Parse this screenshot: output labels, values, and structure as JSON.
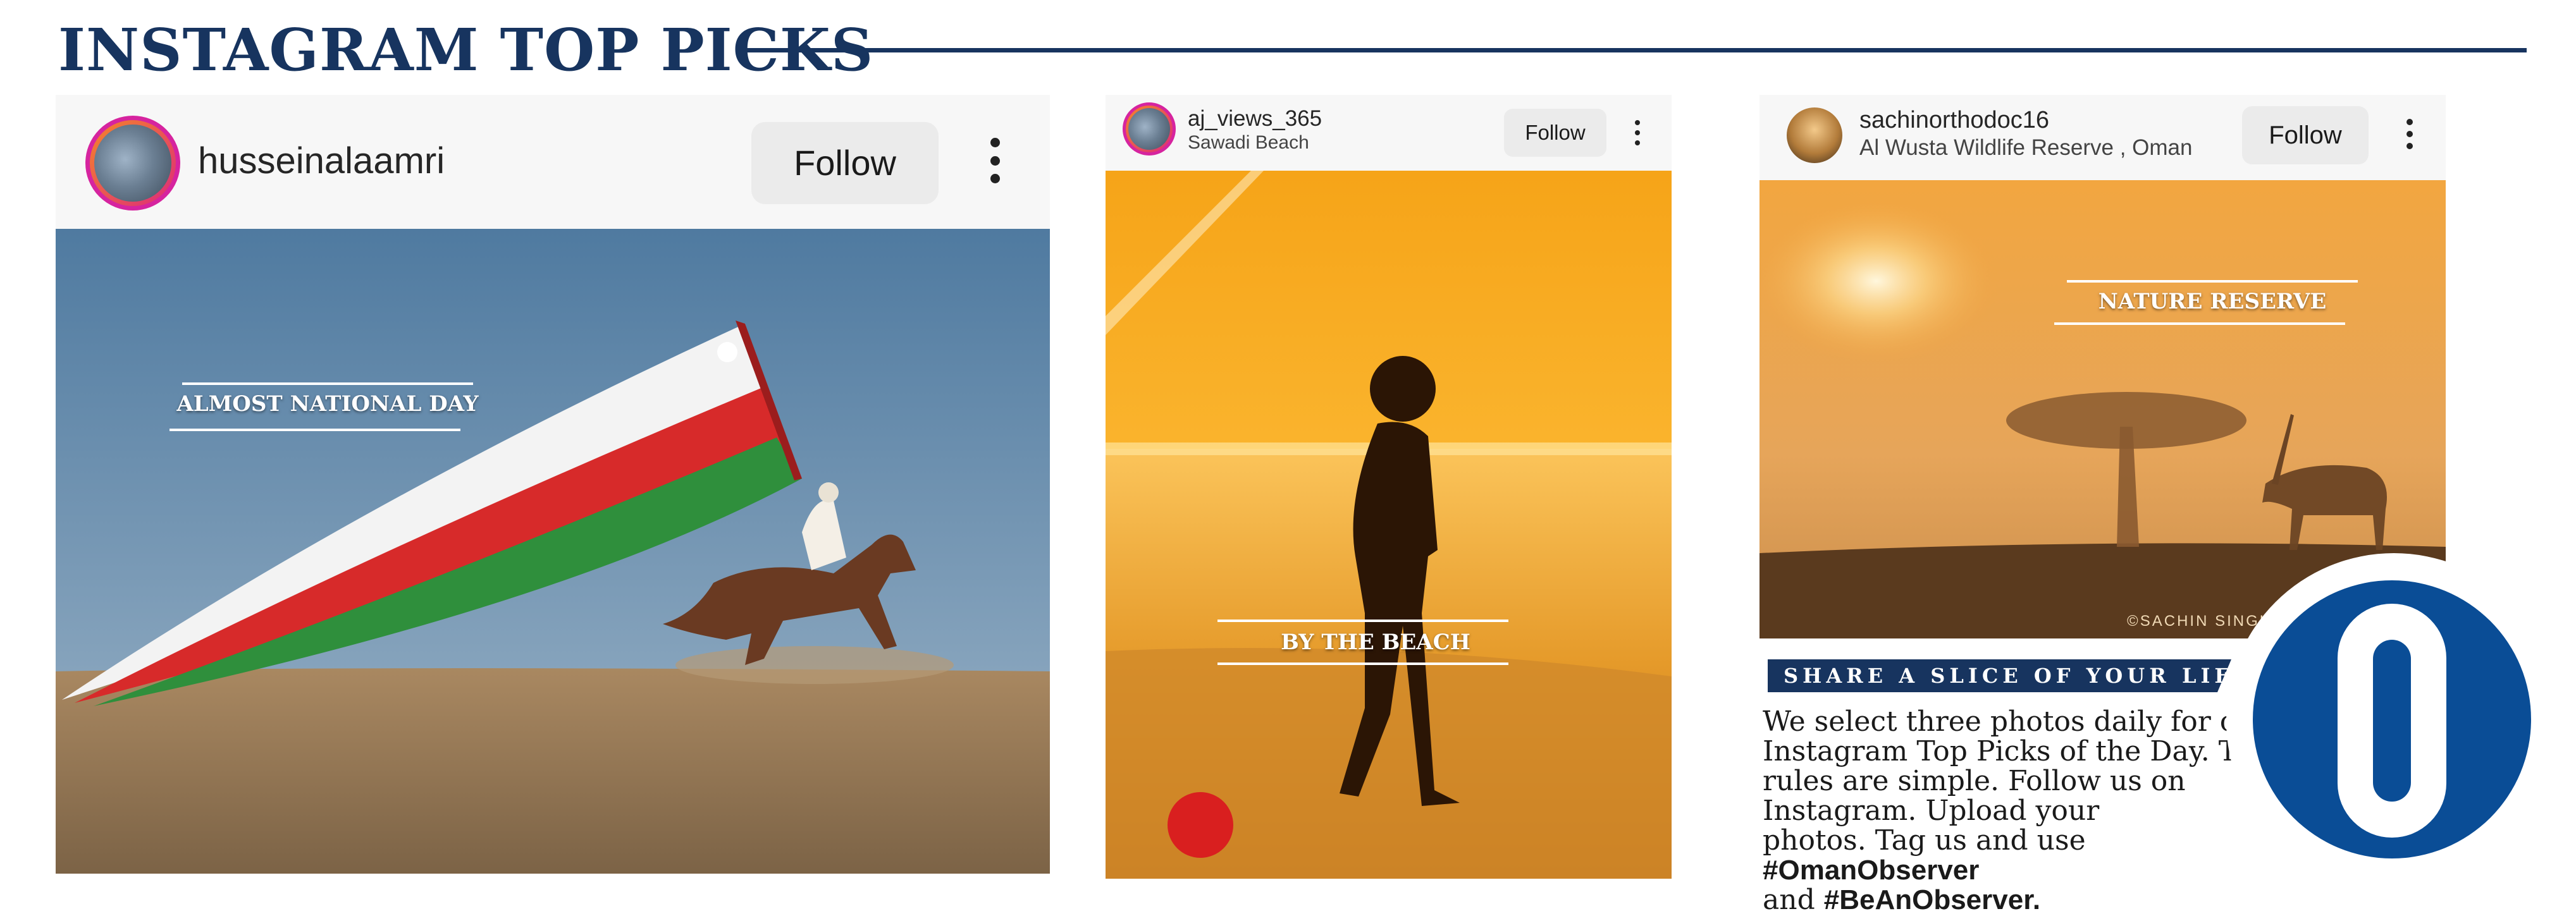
{
  "header": {
    "title": "INSTAGRAM TOP PICKS"
  },
  "posts": [
    {
      "username": "husseinalaamri",
      "location": "",
      "follow_label": "Follow",
      "caption": "ALMOST NATIONAL DAY"
    },
    {
      "username": "aj_views_365",
      "location": "Sawadi Beach",
      "follow_label": "Follow",
      "caption": "BY THE BEACH"
    },
    {
      "username": "sachinorthodoc16",
      "location": "Al Wusta Wildlife Reserve , Oman",
      "follow_label": "Follow",
      "caption": "NATURE RESERVE",
      "watermark": "©SACHIN SINGH PHOTOGRAPHY"
    }
  ],
  "promo": {
    "banner": "SHARE A SLICE OF YOUR LIFE",
    "text_line1": "We select three photos daily for our",
    "text_line2": "Instagram Top Picks of the Day. The",
    "text_line3": "rules are simple. Follow us on",
    "text_line4": "Instagram. Upload your",
    "text_line5a": "photos. Tag us and use ",
    "hashtag1": "#OmanObserver",
    "text_line6a": "and ",
    "hashtag2": "#BeAnObserver."
  },
  "logo": {
    "letter": "O",
    "color": "#0a4d96"
  },
  "colors": {
    "navy": "#17345f",
    "ring": "#d6249f"
  }
}
